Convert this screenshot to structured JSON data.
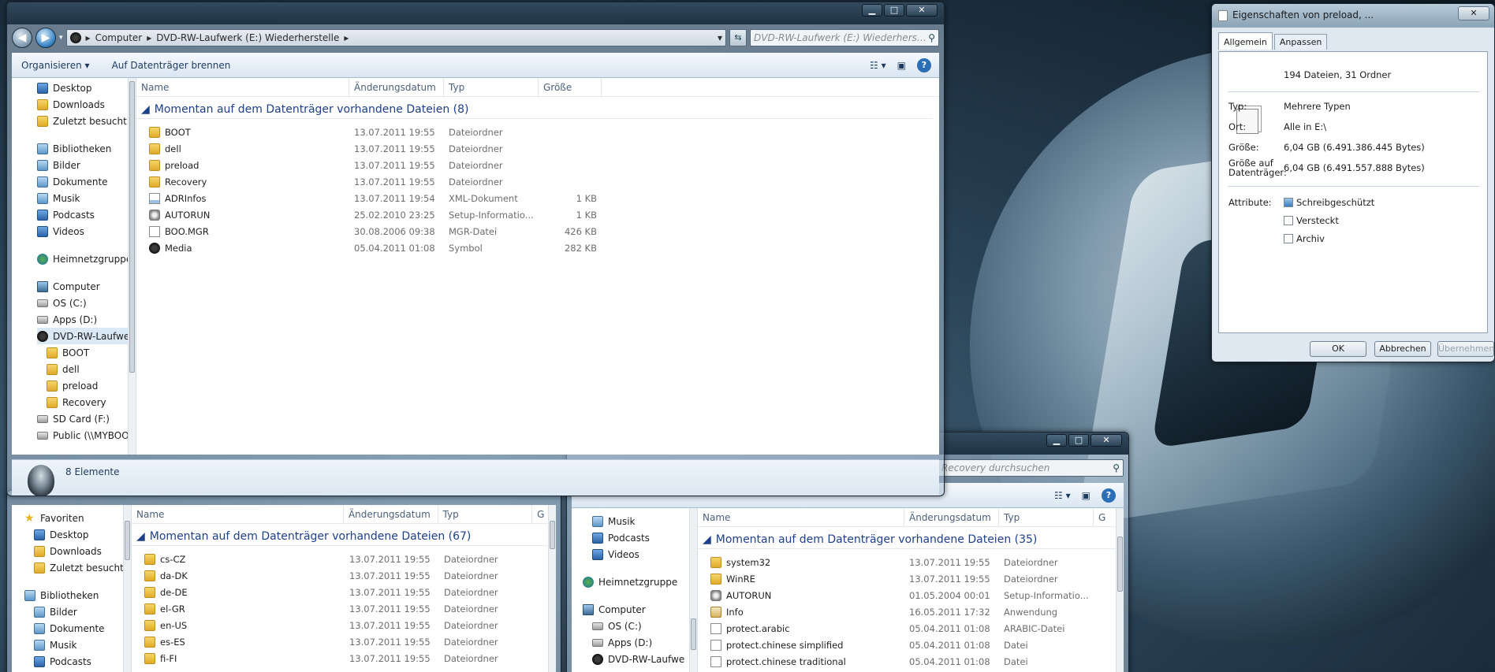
{
  "main_window": {
    "address": {
      "segments": [
        "Computer",
        "DVD-RW-Laufwerk (E:) Wiederherstelle"
      ]
    },
    "search": {
      "placeholder": "DVD-RW-Laufwerk (E:) Wiederherstell..."
    },
    "toolbar": {
      "organize": "Organisieren",
      "burn": "Auf Datenträger brennen"
    },
    "nav": {
      "items": [
        {
          "label": "Desktop",
          "icon": "desktop-icon"
        },
        {
          "label": "Downloads",
          "icon": "downloads-icon"
        },
        {
          "label": "Zuletzt besucht",
          "icon": "recent-icon"
        },
        {
          "label": "Bibliotheken",
          "icon": "libraries-icon"
        },
        {
          "label": "Bilder",
          "icon": "pictures-icon"
        },
        {
          "label": "Dokumente",
          "icon": "documents-icon"
        },
        {
          "label": "Musik",
          "icon": "music-icon"
        },
        {
          "label": "Podcasts",
          "icon": "podcasts-icon"
        },
        {
          "label": "Videos",
          "icon": "videos-icon"
        },
        {
          "label": "Heimnetzgruppe",
          "icon": "homegroup-icon"
        },
        {
          "label": "Computer",
          "icon": "computer-icon"
        },
        {
          "label": "OS (C:)",
          "icon": "drive-icon"
        },
        {
          "label": "Apps (D:)",
          "icon": "drive-icon"
        },
        {
          "label": "DVD-RW-Laufwe",
          "icon": "dvd-drive-icon"
        },
        {
          "label": "BOOT",
          "icon": "folder-icon"
        },
        {
          "label": "dell",
          "icon": "folder-icon"
        },
        {
          "label": "preload",
          "icon": "folder-icon"
        },
        {
          "label": "Recovery",
          "icon": "folder-icon"
        },
        {
          "label": "SD Card (F:)",
          "icon": "sd-card-icon"
        },
        {
          "label": "Public (\\\\MYBOO",
          "icon": "network-drive-icon"
        }
      ]
    },
    "columns": {
      "name": "Name",
      "date": "Änderungsdatum",
      "type": "Typ",
      "size": "Größe"
    },
    "group_title": "Momentan auf dem Datenträger vorhandene Dateien (8)",
    "files": [
      {
        "name": "BOOT",
        "date": "13.07.2011 19:55",
        "type": "Dateiordner",
        "size": "",
        "icon": "folder-icon"
      },
      {
        "name": "dell",
        "date": "13.07.2011 19:55",
        "type": "Dateiordner",
        "size": "",
        "icon": "folder-icon"
      },
      {
        "name": "preload",
        "date": "13.07.2011 19:55",
        "type": "Dateiordner",
        "size": "",
        "icon": "folder-icon"
      },
      {
        "name": "Recovery",
        "date": "13.07.2011 19:55",
        "type": "Dateiordner",
        "size": "",
        "icon": "folder-icon"
      },
      {
        "name": "ADRInfos",
        "date": "13.07.2011 19:54",
        "type": "XML-Dokument",
        "size": "1 KB",
        "icon": "xml-file-icon"
      },
      {
        "name": "AUTORUN",
        "date": "25.02.2010 23:25",
        "type": "Setup-Informatio...",
        "size": "1 KB",
        "icon": "setup-file-icon"
      },
      {
        "name": "BOO.MGR",
        "date": "30.08.2006 09:38",
        "type": "MGR-Datei",
        "size": "426 KB",
        "icon": "file-icon"
      },
      {
        "name": "Media",
        "date": "05.04.2011 01:08",
        "type": "Symbol",
        "size": "282 KB",
        "icon": "alien-icon"
      }
    ],
    "status": "8 Elemente"
  },
  "back_left_window": {
    "nav": [
      {
        "label": "Favoriten",
        "icon": "favorites-icon"
      },
      {
        "label": "Desktop",
        "icon": "desktop-icon"
      },
      {
        "label": "Downloads",
        "icon": "downloads-icon"
      },
      {
        "label": "Zuletzt besucht",
        "icon": "recent-icon"
      },
      {
        "label": "Bibliotheken",
        "icon": "libraries-icon"
      },
      {
        "label": "Bilder",
        "icon": "pictures-icon"
      },
      {
        "label": "Dokumente",
        "icon": "documents-icon"
      },
      {
        "label": "Musik",
        "icon": "music-icon"
      },
      {
        "label": "Podcasts",
        "icon": "podcasts-icon"
      }
    ],
    "columns": {
      "name": "Name",
      "date": "Änderungsdatum",
      "type": "Typ",
      "extra": "G"
    },
    "group_title": "Momentan auf dem Datenträger vorhandene Dateien (67)",
    "files": [
      {
        "name": "cs-CZ",
        "date": "13.07.2011 19:55",
        "type": "Dateiordner"
      },
      {
        "name": "da-DK",
        "date": "13.07.2011 19:55",
        "type": "Dateiordner"
      },
      {
        "name": "de-DE",
        "date": "13.07.2011 19:55",
        "type": "Dateiordner"
      },
      {
        "name": "el-GR",
        "date": "13.07.2011 19:55",
        "type": "Dateiordner"
      },
      {
        "name": "en-US",
        "date": "13.07.2011 19:55",
        "type": "Dateiordner"
      },
      {
        "name": "es-ES",
        "date": "13.07.2011 19:55",
        "type": "Dateiordner"
      },
      {
        "name": "fi-FI",
        "date": "13.07.2011 19:55",
        "type": "Dateiordner"
      }
    ]
  },
  "back_right_window": {
    "search": {
      "placeholder": "Recovery durchsuchen"
    },
    "nav": [
      {
        "label": "Musik",
        "icon": "music-icon"
      },
      {
        "label": "Podcasts",
        "icon": "podcasts-icon"
      },
      {
        "label": "Videos",
        "icon": "videos-icon"
      },
      {
        "label": "Heimnetzgruppe",
        "icon": "homegroup-icon"
      },
      {
        "label": "Computer",
        "icon": "computer-icon"
      },
      {
        "label": "OS (C:)",
        "icon": "drive-icon"
      },
      {
        "label": "Apps (D:)",
        "icon": "drive-icon"
      },
      {
        "label": "DVD-RW-Laufwe",
        "icon": "dvd-drive-icon"
      }
    ],
    "columns": {
      "name": "Name",
      "date": "Änderungsdatum",
      "type": "Typ",
      "extra": "G"
    },
    "group_title": "Momentan auf dem Datenträger vorhandene Dateien (35)",
    "files": [
      {
        "name": "system32",
        "date": "13.07.2011 19:55",
        "type": "Dateiordner",
        "icon": "folder-icon"
      },
      {
        "name": "WinRE",
        "date": "13.07.2011 19:55",
        "type": "Dateiordner",
        "icon": "folder-icon"
      },
      {
        "name": "AUTORUN",
        "date": "01.05.2004 00:01",
        "type": "Setup-Informatio...",
        "icon": "setup-file-icon"
      },
      {
        "name": "Info",
        "date": "16.05.2011 17:32",
        "type": "Anwendung",
        "icon": "application-icon"
      },
      {
        "name": "protect.arabic",
        "date": "05.04.2011 01:08",
        "type": "ARABIC-Datei",
        "icon": "file-icon"
      },
      {
        "name": "protect.chinese simplified",
        "date": "05.04.2011 01:08",
        "type": "Datei",
        "icon": "file-icon"
      },
      {
        "name": "protect.chinese traditional",
        "date": "05.04.2011 01:08",
        "type": "Datei",
        "icon": "file-icon"
      }
    ]
  },
  "properties_dialog": {
    "title": "Eigenschaften von preload, ...",
    "tabs": [
      "Allgemein",
      "Anpassen"
    ],
    "summary": "194 Dateien, 31 Ordner",
    "typ_label": "Typ:",
    "typ_value": "Mehrere Typen",
    "ort_label": "Ort:",
    "ort_value": "Alle in E:\\",
    "groesse_label": "Größe:",
    "groesse_value": "6,04 GB (6.491.386.445 Bytes)",
    "groesse_disk_label_1": "Größe auf",
    "groesse_disk_label_2": "Datenträger:",
    "groesse_disk_value": "6,04 GB (6.491.557.888 Bytes)",
    "attribute_label": "Attribute:",
    "attributes": [
      {
        "label": "Schreibgeschützt",
        "checked": true
      },
      {
        "label": "Versteckt",
        "checked": false
      },
      {
        "label": "Archiv",
        "checked": false
      }
    ],
    "buttons": {
      "ok": "OK",
      "cancel": "Abbrechen",
      "apply": "Übernehmen"
    }
  }
}
